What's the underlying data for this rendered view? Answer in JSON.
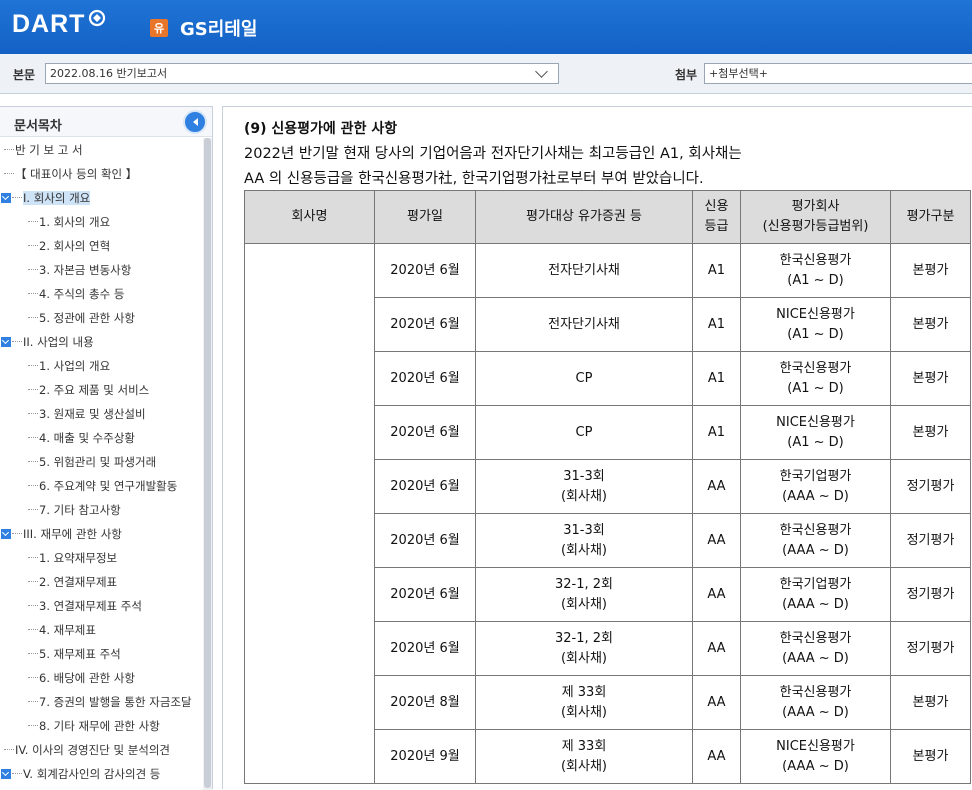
{
  "header": {
    "logo": "DART",
    "company_badge": "유",
    "company_name": "GS리테일"
  },
  "docbar": {
    "body_label": "본문",
    "body_value": "2022.08.16  반기보고서",
    "attach_label": "첨부",
    "attach_value": "+첨부선택+"
  },
  "sidebar": {
    "title": "문서목차",
    "items": [
      {
        "label": "반 기 보 고 서",
        "level": 0
      },
      {
        "label": "【 대표이사 등의 확인 】",
        "level": 0
      },
      {
        "label": "I. 회사의 개요",
        "level": "section",
        "selected": true
      },
      {
        "label": "1. 회사의 개요",
        "level": 1
      },
      {
        "label": "2. 회사의 연혁",
        "level": 1
      },
      {
        "label": "3. 자본금 변동사항",
        "level": 1
      },
      {
        "label": "4. 주식의 총수 등",
        "level": 1
      },
      {
        "label": "5. 정관에 관한 사항",
        "level": 1
      },
      {
        "label": "II. 사업의 내용",
        "level": "section"
      },
      {
        "label": "1. 사업의 개요",
        "level": 1
      },
      {
        "label": "2. 주요 제품 및 서비스",
        "level": 1
      },
      {
        "label": "3. 원재료 및 생산설비",
        "level": 1
      },
      {
        "label": "4. 매출 및 수주상황",
        "level": 1
      },
      {
        "label": "5. 위험관리 및 파생거래",
        "level": 1
      },
      {
        "label": "6. 주요계약 및 연구개발활동",
        "level": 1
      },
      {
        "label": "7. 기타 참고사항",
        "level": 1
      },
      {
        "label": "III. 재무에 관한 사항",
        "level": "section"
      },
      {
        "label": "1. 요약재무정보",
        "level": 1
      },
      {
        "label": "2. 연결재무제표",
        "level": 1
      },
      {
        "label": "3. 연결재무제표 주석",
        "level": 1
      },
      {
        "label": "4. 재무제표",
        "level": 1
      },
      {
        "label": "5. 재무제표 주석",
        "level": 1
      },
      {
        "label": "6. 배당에 관한 사항",
        "level": 1
      },
      {
        "label": "7. 증권의 발행을 통한 자금조달",
        "level": 1
      },
      {
        "label": "8. 기타 재무에 관한 사항",
        "level": 1
      },
      {
        "label": "IV. 이사의 경영진단 및 분석의견",
        "level": 0
      },
      {
        "label": "V. 회계감사인의 감사의견 등",
        "level": "section"
      }
    ]
  },
  "main": {
    "section_title": "(9) 신용평가에 관한 사항",
    "para_line1": "2022년 반기말 현재 당사의 기업어음과 전자단기사채는 최고등급인 A1, 회사채는",
    "para_line2": "AA 의 신용등급을 한국신용평가社, 한국기업평가社로부터 부여 받았습니다.",
    "table": {
      "headers": [
        "회사명",
        "평가일",
        "평가대상 유가증권 등",
        "신용\n등급",
        "평가회사\n(신용평가등급범위)",
        "평가구분"
      ],
      "rows": [
        [
          "",
          "2020년 6월",
          "전자단기사채",
          "A1",
          "한국신용평가\n(A1 ~ D)",
          "본평가"
        ],
        [
          "",
          "2020년 6월",
          "전자단기사채",
          "A1",
          "NICE신용평가\n(A1 ~ D)",
          "본평가"
        ],
        [
          "",
          "2020년 6월",
          "CP",
          "A1",
          "한국신용평가\n(A1 ~ D)",
          "본평가"
        ],
        [
          "",
          "2020년 6월",
          "CP",
          "A1",
          "NICE신용평가\n(A1 ~ D)",
          "본평가"
        ],
        [
          "",
          "2020년 6월",
          "31-3회\n(회사채)",
          "AA",
          "한국기업평가\n(AAA ~ D)",
          "정기평가"
        ],
        [
          "",
          "2020년 6월",
          "31-3회\n(회사채)",
          "AA",
          "한국신용평가\n(AAA ~ D)",
          "정기평가"
        ],
        [
          "",
          "2020년 6월",
          "32-1, 2회\n(회사채)",
          "AA",
          "한국기업평가\n(AAA ~ D)",
          "정기평가"
        ],
        [
          "",
          "2020년 6월",
          "32-1, 2회\n(회사채)",
          "AA",
          "한국신용평가\n(AAA ~ D)",
          "정기평가"
        ],
        [
          "",
          "2020년 8월",
          "제 33회\n(회사채)",
          "AA",
          "한국신용평가\n(AAA ~ D)",
          "본평가"
        ],
        [
          "",
          "2020년 9월",
          "제 33회\n(회사채)",
          "AA",
          "NICE신용평가\n(AAA ~ D)",
          "본평가"
        ]
      ]
    }
  }
}
